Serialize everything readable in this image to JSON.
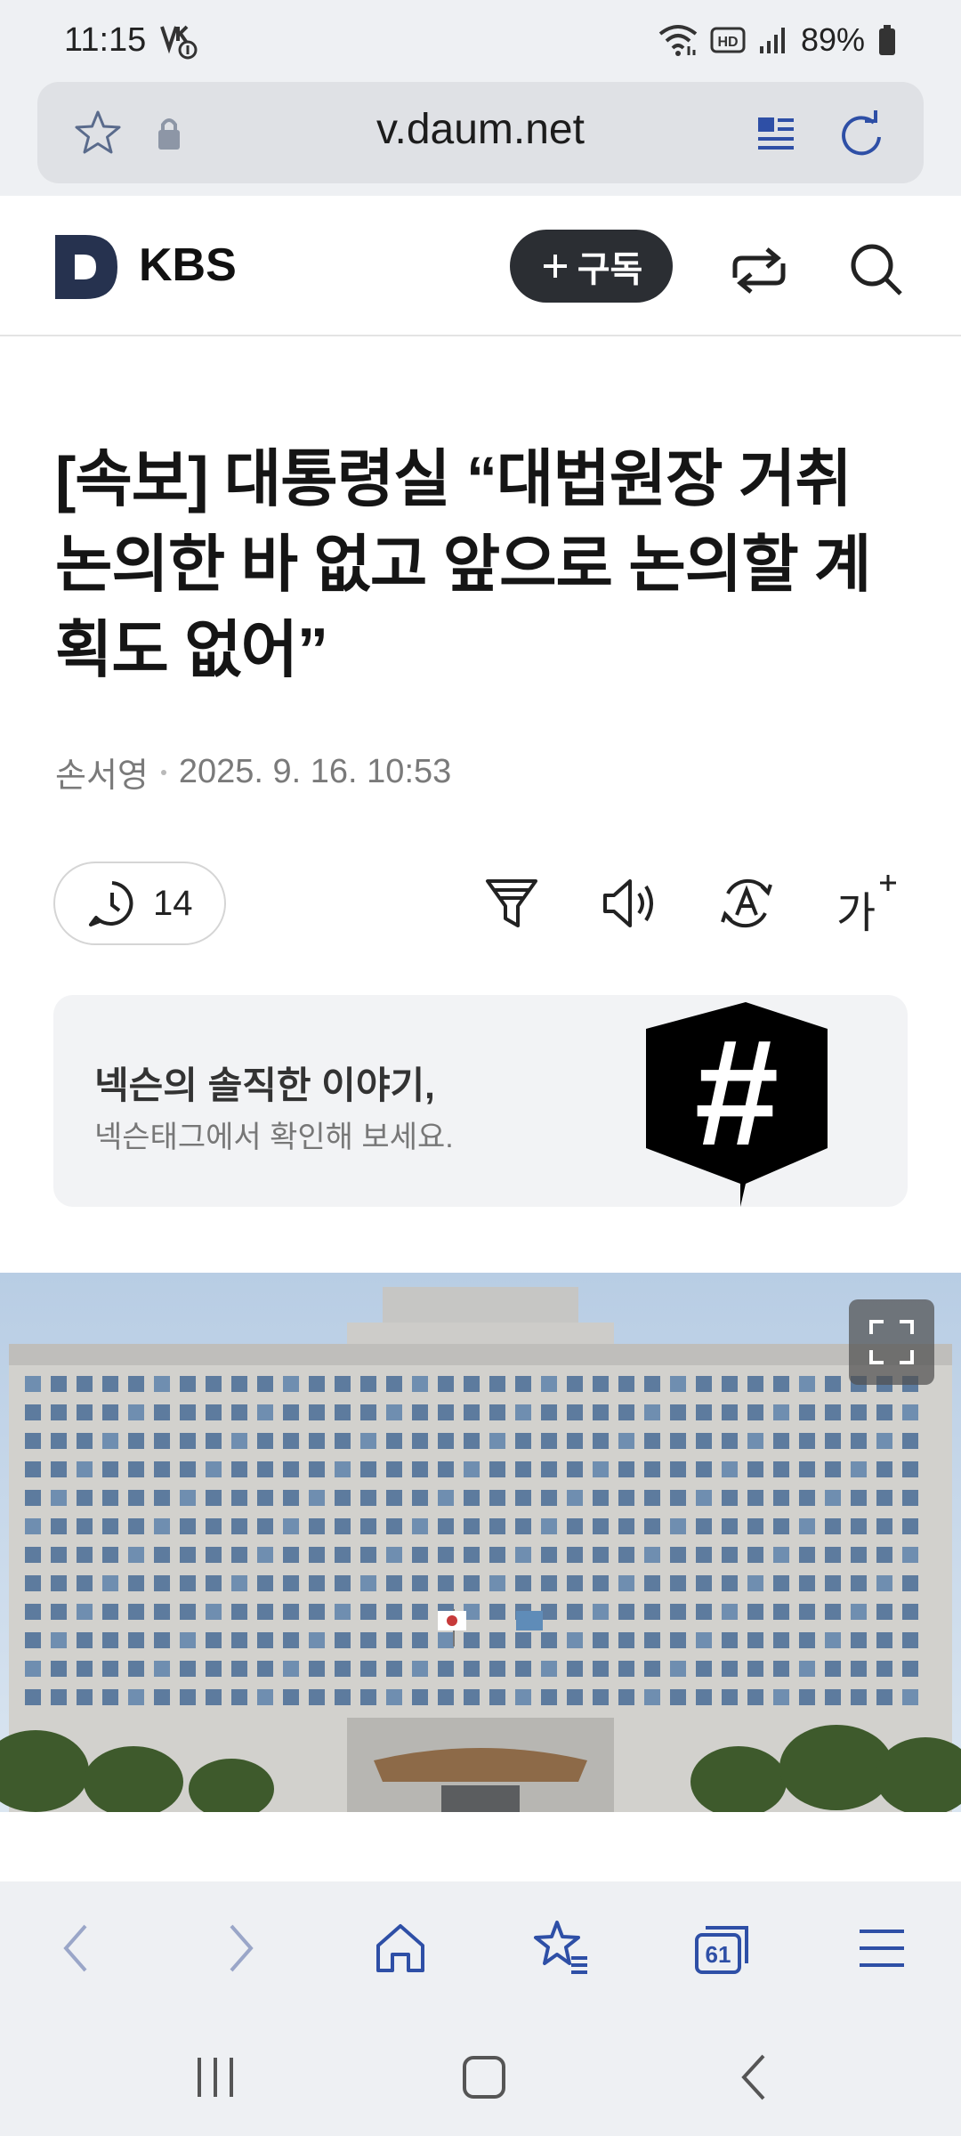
{
  "status_bar": {
    "time": "11:15",
    "battery_percent": "89%",
    "indicators": [
      "vowifi-icon",
      "wifi-icon",
      "hd-icon",
      "signal-icon",
      "battery-icon"
    ]
  },
  "address_bar": {
    "url": "v.daum.net"
  },
  "site_header": {
    "brand_name": "KBS",
    "subscribe_label": "구독",
    "brand_color": "#26324f"
  },
  "article": {
    "title": "[속보] 대통령실 “대법원장 거취 논의한 바 없고 앞으로 논의할 계획도 없어”",
    "author": "손서영",
    "datetime": "2025. 9. 16. 10:53",
    "reading_count": "14",
    "font_size_label": "가"
  },
  "promo": {
    "title": "넥슨의 솔직한 이야기,",
    "subtitle": "넥슨태그에서 확인해 보세요.",
    "logo_symbol": "#"
  },
  "browser_bottom": {
    "tabs_count": "61"
  },
  "colors": {
    "accent_blue": "#2e4fa6",
    "chrome_background": "#eef0f3",
    "button_dark": "#2b2e33"
  }
}
